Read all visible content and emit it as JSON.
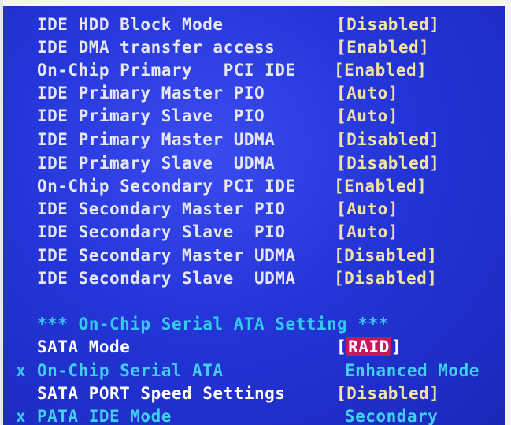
{
  "settings": [
    {
      "label": "IDE HDD Block Mode",
      "value": "[Disabled]"
    },
    {
      "label": "IDE DMA transfer access",
      "value": "[Enabled]"
    },
    {
      "label": "On-Chip Primary   PCI IDE",
      "value": "[Enabled]"
    },
    {
      "label": "IDE Primary Master PIO",
      "value": "[Auto]"
    },
    {
      "label": "IDE Primary Slave  PIO",
      "value": "[Auto]"
    },
    {
      "label": "IDE Primary Master UDMA",
      "value": "[Disabled]"
    },
    {
      "label": "IDE Primary Slave  UDMA",
      "value": "[Disabled]"
    },
    {
      "label": "On-Chip Secondary PCI IDE",
      "value": "[Enabled]"
    },
    {
      "label": "IDE Secondary Master PIO",
      "value": "[Auto]"
    },
    {
      "label": "IDE Secondary Slave  PIO",
      "value": "[Auto]"
    },
    {
      "label": "IDE Secondary Master UDMA",
      "value": "[Disabled]"
    },
    {
      "label": "IDE Secondary Slave  UDMA",
      "value": "[Disabled]"
    }
  ],
  "sata_section": {
    "header": "*** On-Chip Serial ATA Setting ***",
    "sata_mode": {
      "label": "SATA Mode",
      "bracket_open": "[",
      "value": "RAID",
      "bracket_close": "]"
    },
    "onchip_sata": {
      "mark": "x",
      "label": "On-Chip Serial ATA",
      "value": "Enhanced Mode"
    },
    "port_speed": {
      "label": "SATA PORT Speed Settings",
      "value": "[Disabled]"
    },
    "pata_mode": {
      "mark": "x",
      "label": "PATA IDE Mode",
      "value": "Secondary"
    }
  },
  "colors": {
    "background": "#2435d8",
    "label_text": "#e6e6f4",
    "value_text": "#f3e3a2",
    "disabled_text": "#3fd0ee",
    "highlight": "#c6185a"
  }
}
